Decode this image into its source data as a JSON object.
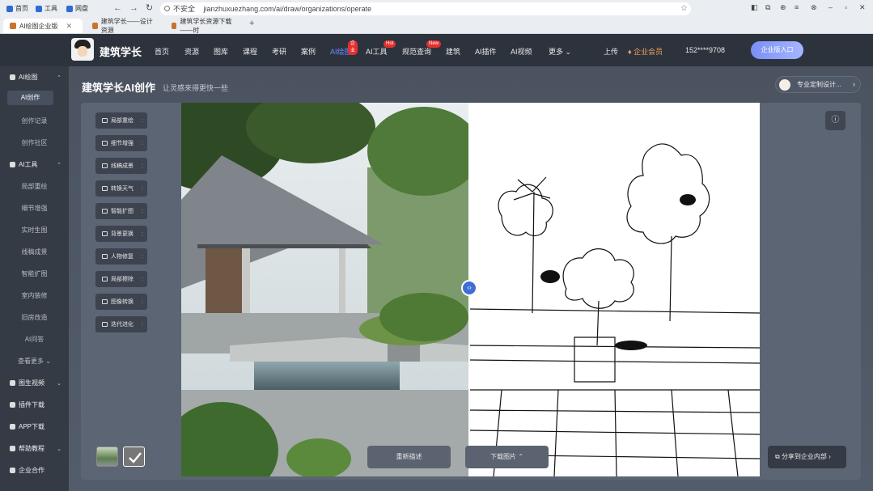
{
  "browser": {
    "favs": [
      "首页",
      "工具",
      "网盘"
    ],
    "nav": {
      "back": "←",
      "forward": "→",
      "reload": "↻",
      "home": "⌂"
    },
    "security": "不安全",
    "url": "jianzhuxuezhang.com/ai/draw/organizations/operate",
    "tabs": [
      {
        "label": "AI绘图企业版"
      },
      {
        "label": "建筑学长——设计资源"
      },
      {
        "label": "建筑学长资源下载——时"
      }
    ],
    "new_tab": "+"
  },
  "header": {
    "brand": "建筑学长",
    "menu": [
      {
        "label": "首页"
      },
      {
        "label": "资源"
      },
      {
        "label": "图库"
      },
      {
        "label": "课程"
      },
      {
        "label": "考研"
      },
      {
        "label": "案例"
      },
      {
        "label": "AI绘图",
        "badge": "企业"
      },
      {
        "label": "AI工具",
        "badge": "Hot"
      },
      {
        "label": "规范查询",
        "badge": "New"
      },
      {
        "label": "建筑"
      },
      {
        "label": "AI插件"
      },
      {
        "label": "AI视频"
      },
      {
        "label": "更多 ⌄"
      }
    ],
    "upload": "上传",
    "vip": "企业会员",
    "phone": "152****9708",
    "enterprise_btn": "企业版入口"
  },
  "sidebar": {
    "group1": "AI绘图",
    "group1_items": [
      "AI创作",
      "创作记录",
      "创作社区"
    ],
    "group2": "AI工具",
    "group2_items": [
      "局部重绘",
      "细节增强",
      "实时生图",
      "线稿成景",
      "智能扩图",
      "室内装修",
      "旧房改造",
      "AI问答",
      "查看更多 ⌄"
    ],
    "group3": "图生视频",
    "group4": "插件下载",
    "group5": "APP下载",
    "group6": "帮助教程",
    "group7": "企业合作"
  },
  "main": {
    "title": "建筑学长AI创作",
    "subtitle": "让灵感来得更快一些",
    "custom_btn": "专业定制设计...",
    "tools": [
      "局部重绘",
      "细节增强",
      "线稿成景",
      "转换天气",
      "智能扩图",
      "背景更换",
      "人物修复",
      "局部擦除",
      "图像转换",
      "迭代进化"
    ],
    "info_icon": "ⓘ",
    "regen_btn": "重新描述",
    "download_btn": "下载图片 ⌃",
    "share_btn": "分享到企业内部"
  },
  "colors": {
    "topbar": "#2d333d",
    "sidebar": "#353b45",
    "accent": "#6d8bff"
  }
}
